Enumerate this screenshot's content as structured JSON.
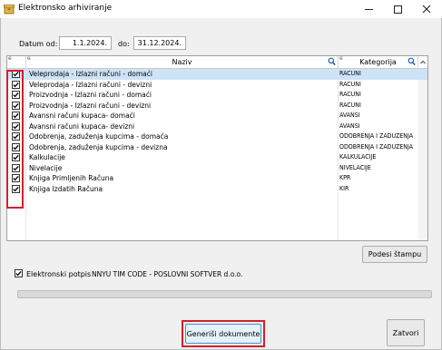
{
  "window": {
    "title": "Elektronsko arhiviranje"
  },
  "filters": {
    "date_from_label": "Datum od:",
    "date_from_value": "1.1.2024.",
    "date_to_label": "do:",
    "date_to_value": "31.12.2024."
  },
  "grid": {
    "columns": [
      {
        "mark": "e",
        "label": ""
      },
      {
        "mark": "e",
        "label": "Naziv"
      },
      {
        "mark": "e",
        "label": "Kategorija"
      }
    ],
    "rows": [
      {
        "checked": true,
        "naziv": "Veleprodaja - Izlazni računi - domaći",
        "kategorija": "RACUNI"
      },
      {
        "checked": true,
        "naziv": "Veleprodaja - Izlazni računi - devizni",
        "kategorija": "RACUNI"
      },
      {
        "checked": true,
        "naziv": "Proizvodnja - Izlazni računi - domaći",
        "kategorija": "RACUNI"
      },
      {
        "checked": true,
        "naziv": "Proizvodnja - Izlazni računi - devizni",
        "kategorija": "RACUNI"
      },
      {
        "checked": true,
        "naziv": "Avansni računi kupaca- domaći",
        "kategorija": "AVANSI"
      },
      {
        "checked": true,
        "naziv": "Avansni računi kupaca- devizni",
        "kategorija": "AVANSI"
      },
      {
        "checked": true,
        "naziv": "Odobrenja, zaduženja kupcima - domaća",
        "kategorija": "ODOBRENJA I ZADUZENJA"
      },
      {
        "checked": true,
        "naziv": "Odobrenja, zaduženja kupcima - devizna",
        "kategorija": "ODOBRENJA I ZADUZENJA"
      },
      {
        "checked": true,
        "naziv": "Kalkulacije",
        "kategorija": "KALKULACIJE"
      },
      {
        "checked": true,
        "naziv": "Nivelacije",
        "kategorija": "NIVELACIJE"
      },
      {
        "checked": true,
        "naziv": "Knjiga Primljenih Računa",
        "kategorija": "KPR"
      },
      {
        "checked": true,
        "naziv": "Knjiga Izdatih Računa",
        "kategorija": "KIR"
      }
    ]
  },
  "buttons": {
    "print_setup": "Podesi štampu",
    "generate": "Generiši dokumente",
    "close": "Zatvori"
  },
  "signature": {
    "checked": true,
    "label": "Elektronski potpis",
    "signer": "NNYU TIM CODE - POSLOVNI SOFTVER d.o.o."
  },
  "progress": {
    "value": 0
  },
  "colors": {
    "highlight": "#d0202a",
    "selected_row": "#cfe3f7"
  }
}
